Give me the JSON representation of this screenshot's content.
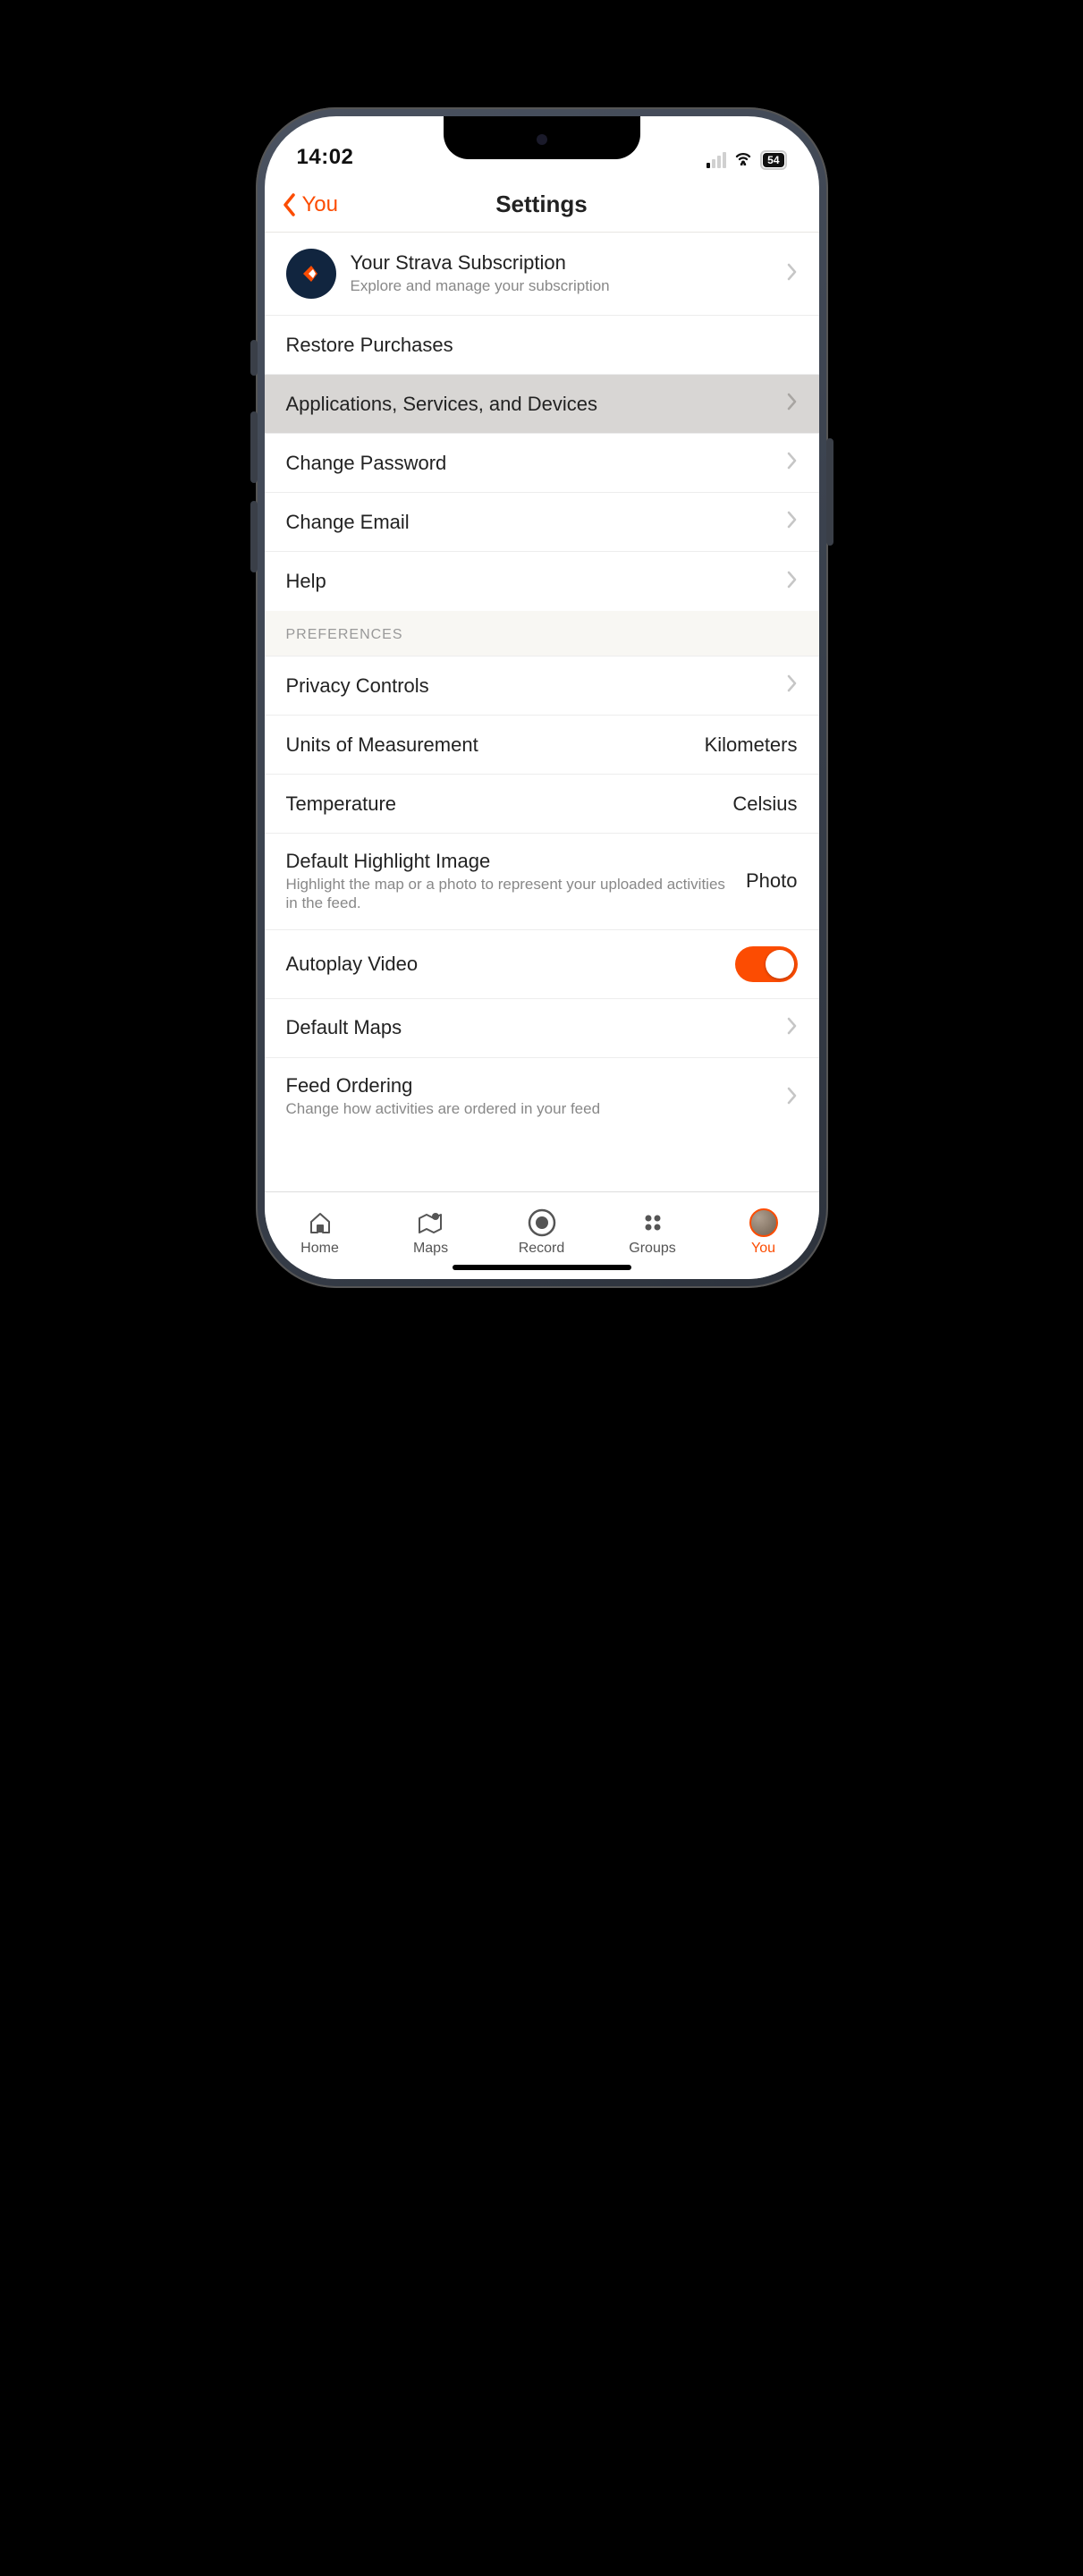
{
  "status": {
    "time": "14:02",
    "battery": "54"
  },
  "header": {
    "back": "You",
    "title": "Settings"
  },
  "rows": {
    "subscription": {
      "title": "Your Strava Subscription",
      "subtitle": "Explore and manage your subscription"
    },
    "restore": "Restore Purchases",
    "apps": "Applications, Services, and Devices",
    "password": "Change Password",
    "email": "Change Email",
    "help": "Help"
  },
  "section_preferences": "PREFERENCES",
  "prefs": {
    "privacy": "Privacy Controls",
    "units": {
      "label": "Units of Measurement",
      "value": "Kilometers"
    },
    "temperature": {
      "label": "Temperature",
      "value": "Celsius"
    },
    "highlight": {
      "label": "Default Highlight Image",
      "sub": "Highlight the map or a photo to represent your uploaded activities in the feed.",
      "value": "Photo"
    },
    "autoplay": {
      "label": "Autoplay Video",
      "on": true
    },
    "maps": "Default Maps",
    "feed": {
      "label": "Feed Ordering",
      "sub": "Change how activities are ordered in your feed"
    }
  },
  "tabs": {
    "home": "Home",
    "maps": "Maps",
    "record": "Record",
    "groups": "Groups",
    "you": "You"
  }
}
